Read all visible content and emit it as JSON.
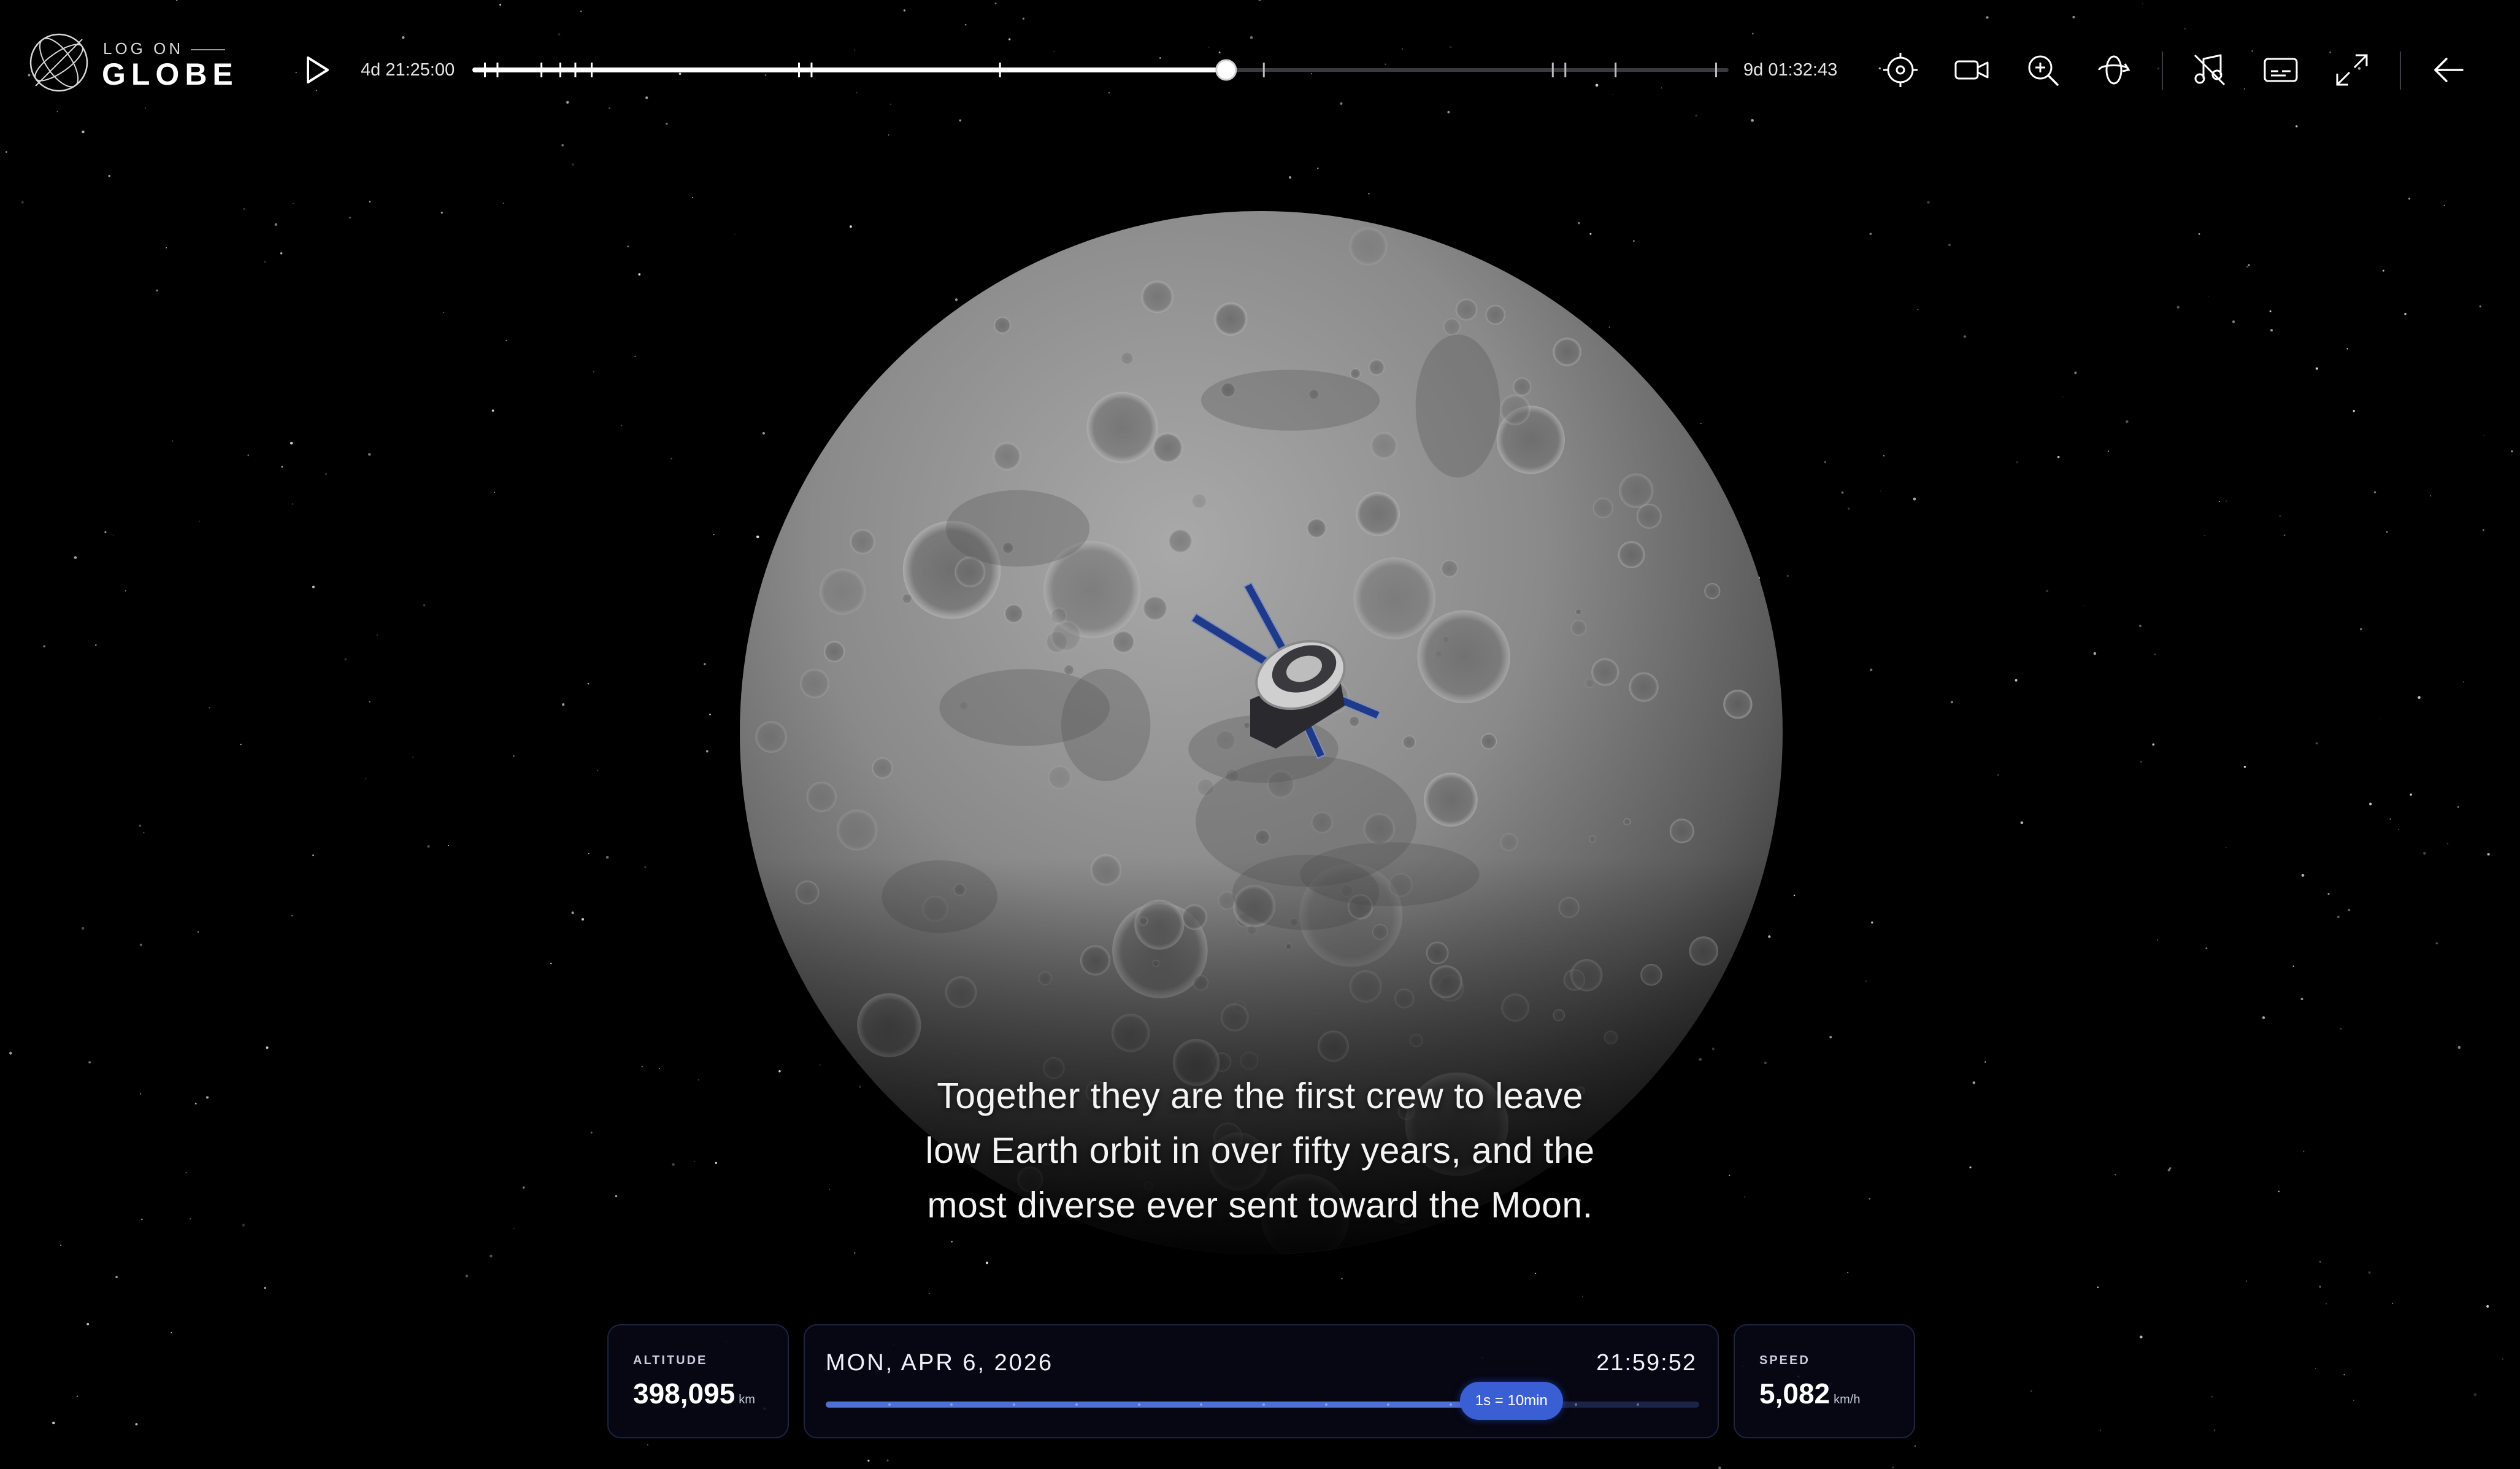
{
  "app": {
    "logo_small": "LOG ON",
    "logo_big": "GLOBE"
  },
  "timeline": {
    "start_label": "4d 21:25:00",
    "end_label": "9d 01:32:43",
    "progress": 0.6,
    "markers": [
      0.01,
      0.02,
      0.055,
      0.07,
      0.082,
      0.095,
      0.26,
      0.27,
      0.42,
      0.63,
      0.86,
      0.87,
      0.91,
      0.99
    ]
  },
  "toolbar": {
    "icons": [
      "target-icon",
      "camera-icon",
      "zoom-in-icon",
      "orbit-icon",
      "music-icon",
      "captions-icon",
      "fullscreen-icon",
      "back-arrow-icon"
    ]
  },
  "caption": {
    "lines": [
      "Together they are the first crew to leave",
      "low Earth orbit in over fifty years, and the",
      "most diverse ever sent toward the Moon."
    ]
  },
  "hud": {
    "altitude": {
      "label": "ALTITUDE",
      "value": "398,095",
      "unit": "km"
    },
    "speed": {
      "label": "SPEED",
      "value": "5,082",
      "unit": "km/h"
    },
    "date": "MON, APR 6, 2026",
    "clock": "21:59:52",
    "time_scale": {
      "label": "1s = 10min",
      "position": 0.785
    }
  },
  "colors": {
    "accent": "#3a5fd4",
    "track": "#1a2348",
    "card_bg": "#060814"
  }
}
